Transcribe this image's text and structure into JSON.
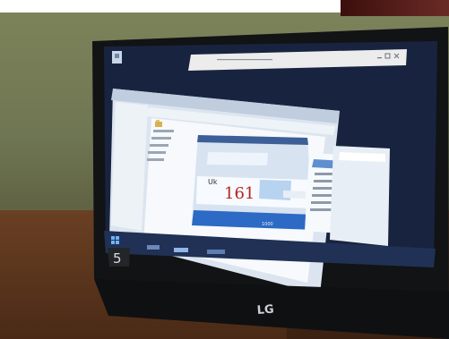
{
  "scene": {
    "logo_text": "LG",
    "key_label": "5",
    "value_display": "161",
    "unit_label": "Uk",
    "footer_value": "1000",
    "title_bar_text": "",
    "window_title": "",
    "status_text": ""
  },
  "colors": {
    "wall": "#6f7652",
    "desk": "#5b331b",
    "monitor_bezel": "#111315",
    "desktop_background": "#18243f",
    "window_frame": "#dce5ef",
    "dialog_titlebar": "#3c5f97",
    "accent_blue": "#2c6ac5",
    "value_red": "#b6221e"
  },
  "icons": [
    "desktop-app-icon",
    "windows-start-icon",
    "taskbar-window-icon",
    "folder-icon",
    "window-close-icon",
    "window-maximize-icon",
    "window-minimize-icon"
  ]
}
